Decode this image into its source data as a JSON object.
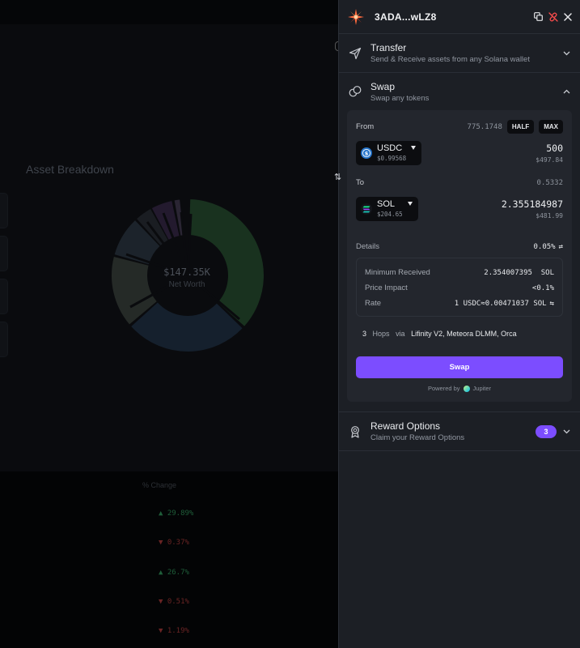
{
  "background": {
    "section_title": "Asset Breakdown",
    "net_worth_value": "$147.35K",
    "net_worth_label": "Net Worth",
    "change_header": "% Change",
    "change_rows": [
      {
        "value": "29.89%",
        "direction": "up"
      },
      {
        "value": "0.37%",
        "direction": "down"
      },
      {
        "value": "26.7%",
        "direction": "up"
      },
      {
        "value": "0.51%",
        "direction": "down"
      },
      {
        "value": "1.19%",
        "direction": "down"
      }
    ]
  },
  "header": {
    "wallet_address": "3ADA...wLZ8",
    "icons": [
      "copy-icon",
      "disconnect-icon",
      "close-icon"
    ]
  },
  "transfer": {
    "title": "Transfer",
    "subtitle": "Send & Receive assets from any Solana wallet"
  },
  "swap": {
    "title": "Swap",
    "subtitle": "Swap any tokens",
    "from": {
      "label": "From",
      "balance": "775.1748",
      "half_label": "HALF",
      "max_label": "MAX",
      "token": "USDC",
      "token_price": "$0.99568",
      "amount": "500",
      "amount_usd": "$497.84"
    },
    "to": {
      "label": "To",
      "balance": "0.5332",
      "token": "SOL",
      "token_price": "$204.65",
      "amount": "2.355184987",
      "amount_usd": "$481.99"
    },
    "details": {
      "label": "Details",
      "slippage": "0.05%",
      "minimum_received_label": "Minimum Received",
      "minimum_received_value": "2.354007395  SOL",
      "price_impact_label": "Price Impact",
      "price_impact_value": "<0.1%",
      "rate_label": "Rate",
      "rate_value": "1 USDC≈0.00471037 SOL"
    },
    "route": {
      "hops_count": "3",
      "hops_label": "Hops",
      "via_label": "via",
      "dexes": "Lifinity V2, Meteora DLMM, Orca"
    },
    "swap_button_label": "Swap",
    "powered_by_label": "Powered by",
    "powered_by_name": "Jupiter"
  },
  "rewards": {
    "title": "Reward Options",
    "subtitle": "Claim your Reward Options",
    "count": "3"
  },
  "colors": {
    "accent": "#7c4dff",
    "panel_bg": "#1c1f25",
    "card_bg": "#23262d"
  }
}
